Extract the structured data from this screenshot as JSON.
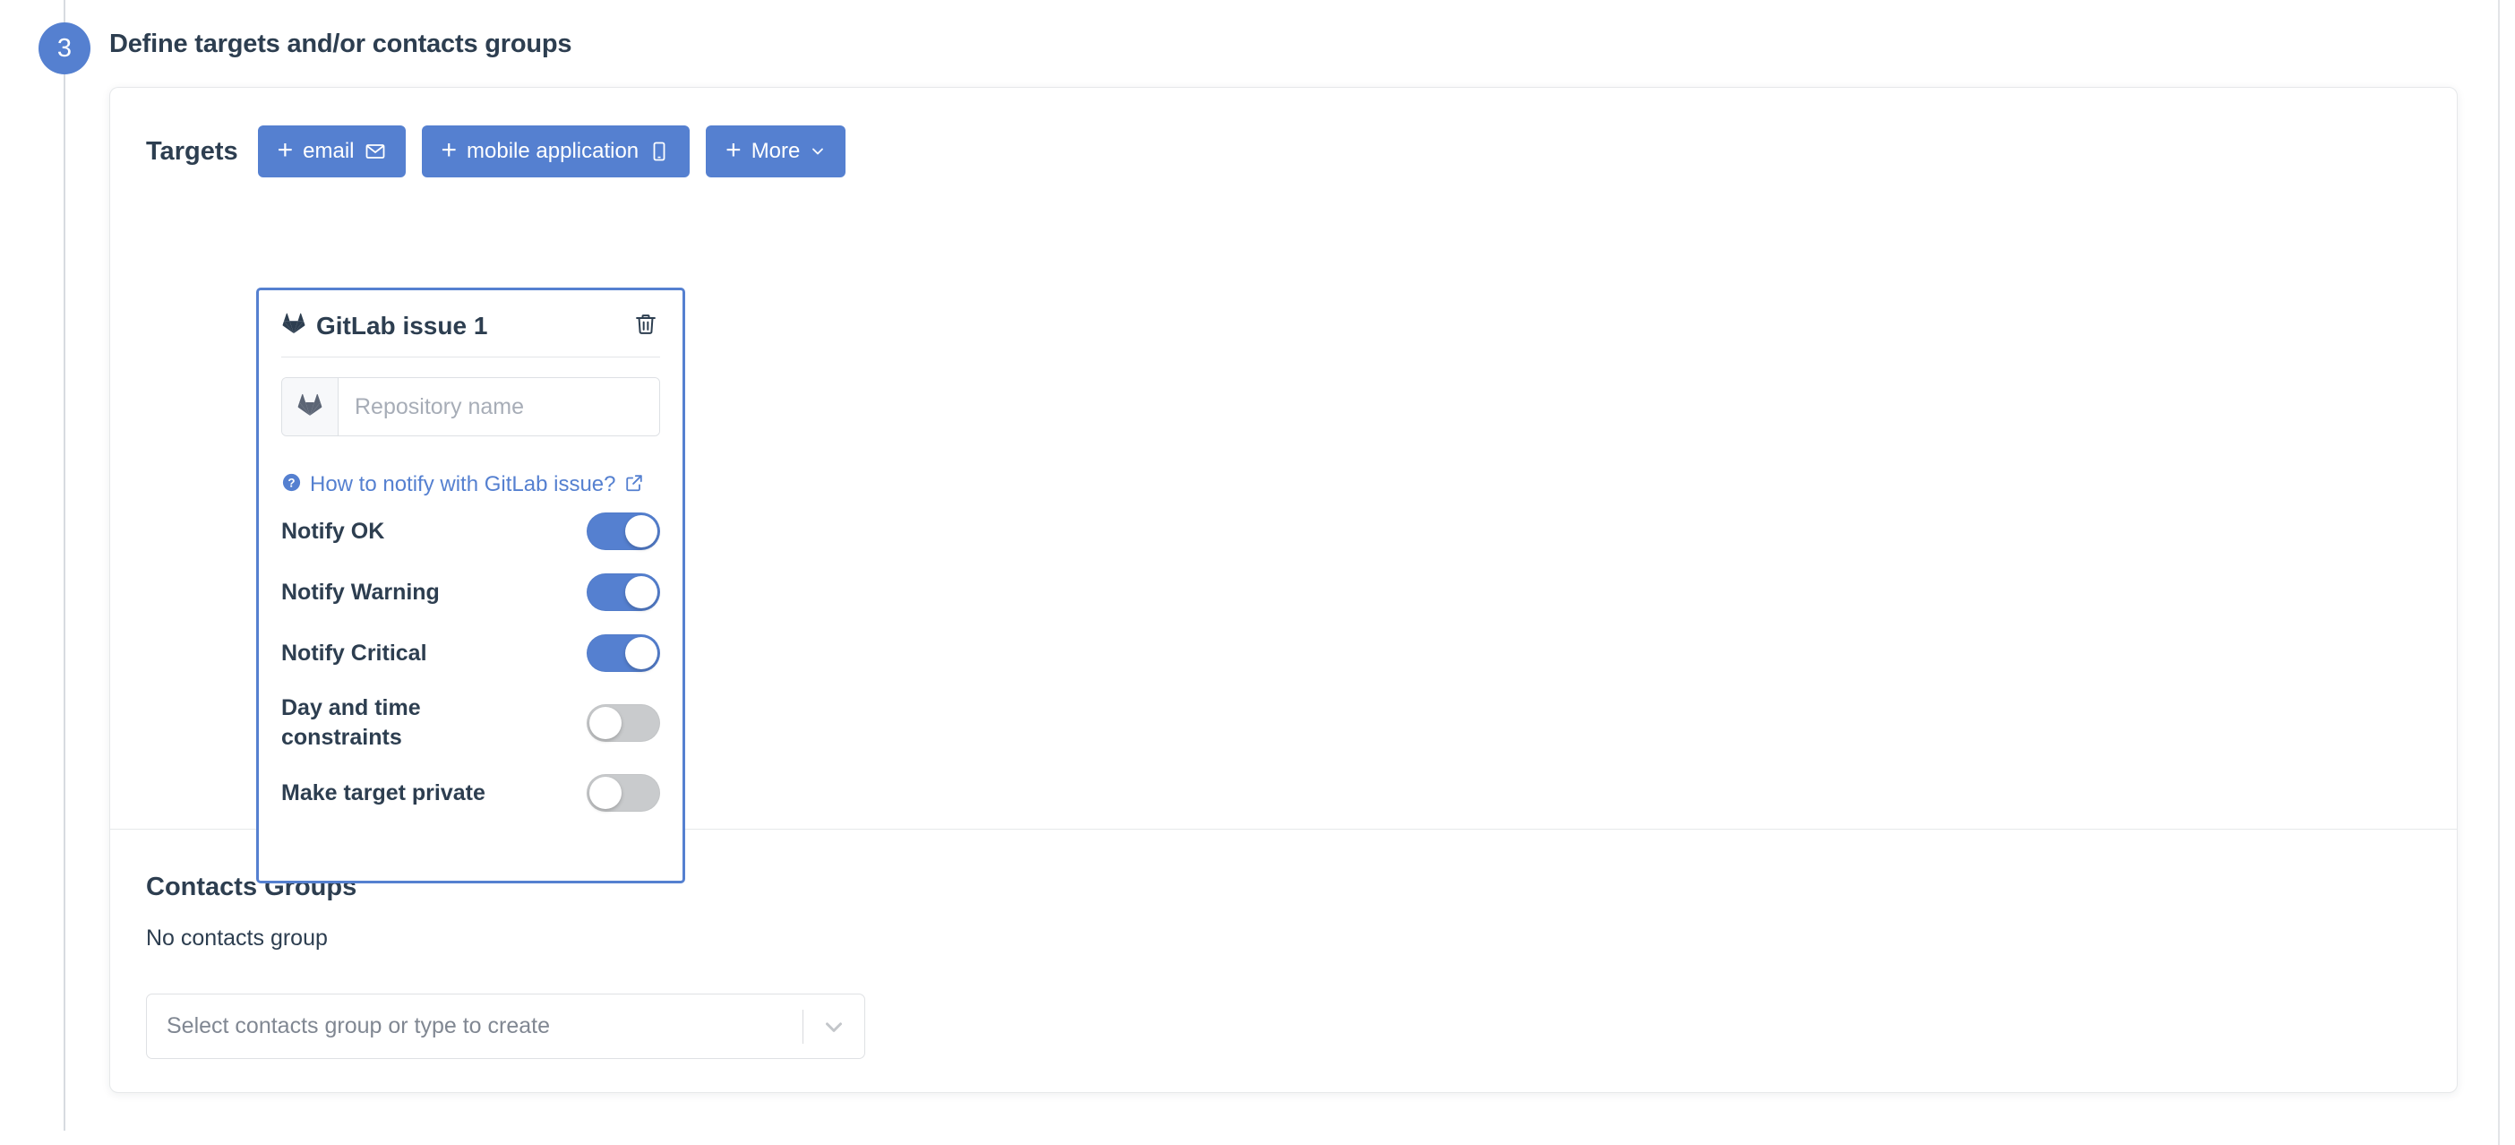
{
  "step": {
    "number": "3",
    "title": "Define targets and/or contacts groups"
  },
  "targets": {
    "title": "Targets",
    "buttons": [
      {
        "label": "email",
        "icon": "envelope-icon"
      },
      {
        "label": "mobile application",
        "icon": "mobile-phone-icon"
      },
      {
        "label": "More",
        "icon": "chevron-down-icon"
      }
    ],
    "card": {
      "title": "GitLab issue 1",
      "icon": "gitlab-icon",
      "delete_icon": "trash-icon",
      "repository_input": {
        "value": "",
        "placeholder": "Repository name",
        "addon_icon": "gitlab-icon"
      },
      "help_link": {
        "text": "How to notify with GitLab issue?",
        "icon": "question-circle-icon",
        "external_icon": "external-link-icon"
      },
      "toggles": [
        {
          "label": "Notify OK",
          "state": "on"
        },
        {
          "label": "Notify Warning",
          "state": "on"
        },
        {
          "label": "Notify Critical",
          "state": "on"
        },
        {
          "label": "Day and time constraints",
          "state": "off"
        },
        {
          "label": "Make target private",
          "state": "off"
        }
      ]
    }
  },
  "contacts": {
    "title": "Contacts Groups",
    "empty_text": "No contacts group",
    "select": {
      "placeholder": "Select contacts group or type to create",
      "chevron_icon": "chevron-down-icon"
    }
  },
  "colors": {
    "accent_blue": "#5580d0",
    "text_dark": "#2d3e50",
    "toggle_off": "#c9cbcd",
    "border_light": "#e6e8ea"
  }
}
